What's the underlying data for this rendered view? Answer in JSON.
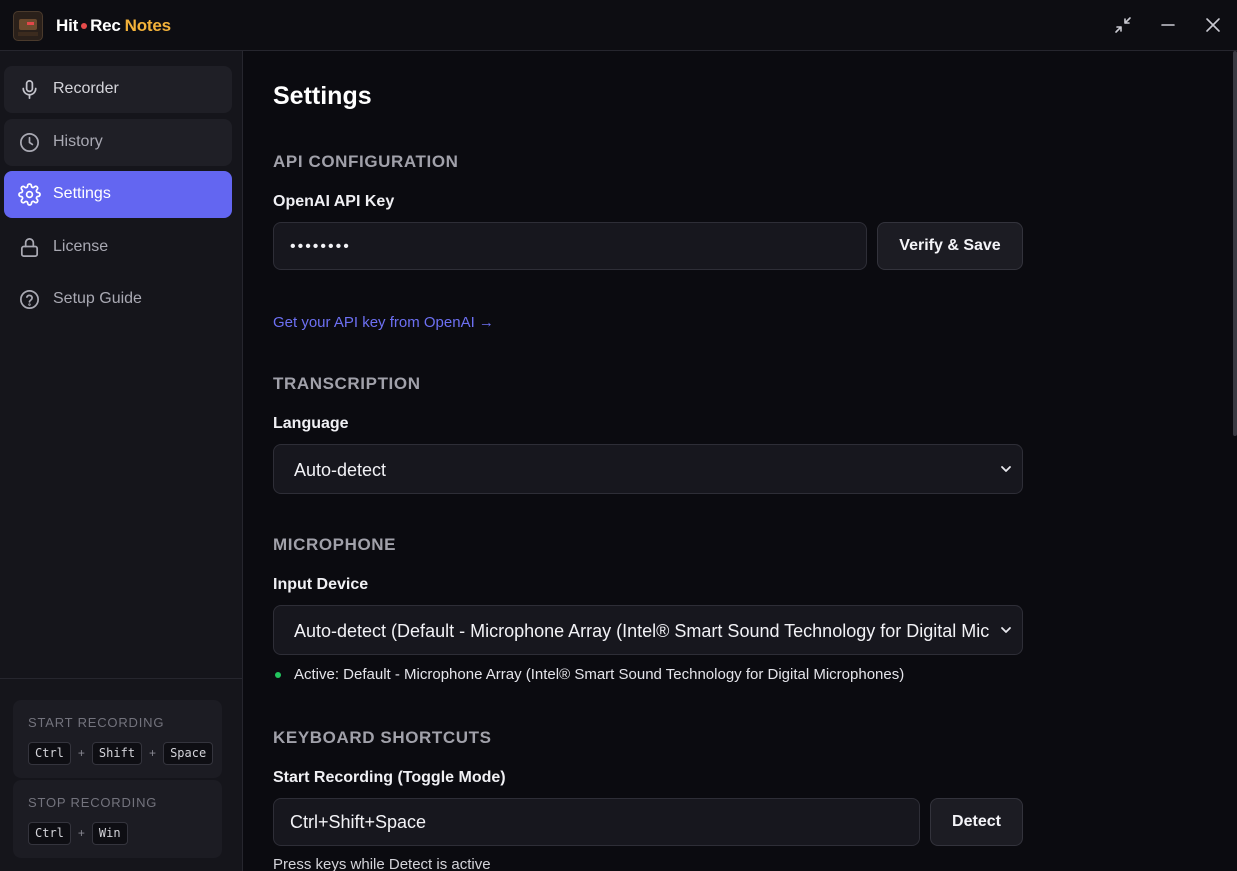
{
  "app": {
    "title_hit": "Hit",
    "title_rec": "Rec",
    "title_notes": "Notes",
    "accent_color": "#6366f1",
    "notes_color": "#f3b23a"
  },
  "window_controls": {
    "icons": [
      "collapse-icon",
      "minimize-icon",
      "close-icon"
    ]
  },
  "sidebar": {
    "items": [
      {
        "label": "Recorder",
        "icon": "microphone-icon"
      },
      {
        "label": "History",
        "icon": "clock-icon"
      },
      {
        "label": "Settings",
        "icon": "gear-icon",
        "active": true
      },
      {
        "label": "License",
        "icon": "lock-icon"
      },
      {
        "label": "Setup Guide",
        "icon": "help-circle-icon"
      }
    ],
    "shortcuts": [
      {
        "title": "START RECORDING",
        "keys": [
          "Ctrl",
          "Shift",
          "Space"
        ]
      },
      {
        "title": "STOP RECORDING",
        "keys": [
          "Ctrl",
          "Win"
        ]
      }
    ]
  },
  "main": {
    "title": "Settings",
    "api": {
      "section": "API CONFIGURATION",
      "label": "OpenAI API Key",
      "value_masked": "••••••••",
      "button": "Verify & Save",
      "link": "Get your API key from OpenAI →"
    },
    "transcription": {
      "section": "TRANSCRIPTION",
      "label": "Language",
      "selected": "Auto-detect"
    },
    "microphone": {
      "section": "MICROPHONE",
      "label": "Input Device",
      "selected": "Auto-detect (Default - Microphone Array (Intel® Smart Sound Technology for Digital Microphones))",
      "status": "Active: Default - Microphone Array (Intel® Smart Sound Technology for Digital Microphones)",
      "status_color": "#22c55e"
    },
    "shortcuts": {
      "section": "KEYBOARD SHORTCUTS",
      "label": "Start Recording (Toggle Mode)",
      "value": "Ctrl+Shift+Space",
      "button": "Detect",
      "hint": "Press keys while Detect is active"
    }
  }
}
